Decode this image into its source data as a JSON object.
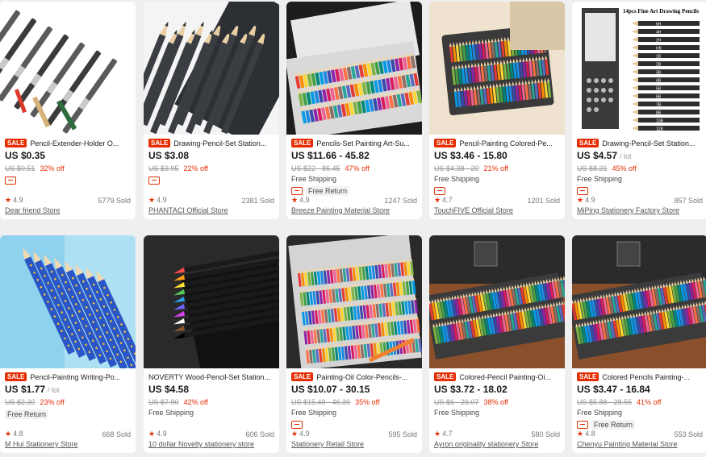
{
  "products": [
    {
      "sale": "SALE",
      "title": "Pencil-Extender-Holder O...",
      "price": "US $0.35",
      "unit": "",
      "orig": "US $0.51",
      "off": "32% off",
      "shipping": "",
      "free_return": "",
      "rating": "4.9",
      "sold": "5779 Sold",
      "store": "Dear friend Store",
      "badge": true,
      "image": "extenders"
    },
    {
      "sale": "SALE",
      "title": "Drawing-Pencil-Set Station...",
      "price": "US $3.08",
      "unit": "",
      "orig": "US $3.95",
      "off": "22% off",
      "shipping": "",
      "free_return": "",
      "rating": "4.9",
      "sold": "2381 Sold",
      "store": "PHANTACI Official Store",
      "badge": true,
      "image": "graphite-box"
    },
    {
      "sale": "SALE",
      "title": "Pencils-Set Painting Art-Su...",
      "price": "US $11.66 - 45.82",
      "unit": "",
      "orig": "US $22 - 86.45",
      "off": "47% off",
      "shipping": "Free Shipping",
      "free_return": "Free Return",
      "rating": "4.9",
      "sold": "1247 Sold",
      "store": "Breeze Painting Material Store",
      "badge": true,
      "image": "color-tins-dark"
    },
    {
      "sale": "SALE",
      "title": "Pencil-Painting Colored-Pe...",
      "price": "US $3.46 - 15.80",
      "unit": "",
      "orig": "US $4.38 - 20",
      "off": "21% off",
      "shipping": "Free Shipping",
      "free_return": "",
      "rating": "4.7",
      "sold": "1201 Sold",
      "store": "TouchFIVE Official Store",
      "badge": true,
      "image": "color-tin-sketch"
    },
    {
      "sale": "SALE",
      "title": "Drawing-Pencil-Set Station...",
      "price": "US $4.57",
      "unit": "/ lot",
      "orig": "US $8.31",
      "off": "45% off",
      "shipping": "Free Shipping",
      "free_return": "",
      "rating": "4.9",
      "sold": "857 Sold",
      "store": "MiPing Stationery Factory Store",
      "badge": true,
      "image": "sketch-set",
      "box_caption": "14pcs Fine Art Drawing Pencils",
      "grades": [
        "6H",
        "4H",
        "2H",
        "HB",
        "1B",
        "2B",
        "3B",
        "4B",
        "5B",
        "6B",
        "7B",
        "8B",
        "10B",
        "12B"
      ]
    },
    {
      "sale": "SALE",
      "title": "Pencil-Painting Writing-Po...",
      "price": "US $1.77",
      "unit": "/ lot",
      "orig": "US $2.30",
      "off": "23% off",
      "shipping": "",
      "free_return": "Free Return",
      "rating": "4.8",
      "sold": "668 Sold",
      "store": "M Hui Stationery Store",
      "badge": false,
      "image": "blue-dots"
    },
    {
      "sale": "",
      "title": "NOVERTY Wood-Pencil-Set Station...",
      "price": "US $4.58",
      "unit": "",
      "orig": "US $7.90",
      "off": "42% off",
      "shipping": "Free Shipping",
      "free_return": "",
      "rating": "4.9",
      "sold": "606 Sold",
      "store": "10 dollar Novelty stationery store",
      "badge": false,
      "image": "black-fan"
    },
    {
      "sale": "SALE",
      "title": "Painting-Oil Color-Pencils-...",
      "price": "US $10.07 - 30.15",
      "unit": "",
      "orig": "US $15.49 - 46.39",
      "off": "35% off",
      "shipping": "Free Shipping",
      "free_return": "",
      "rating": "4.9",
      "sold": "595 Sold",
      "store": "Stationery Retail Store",
      "badge": true,
      "image": "color-tin-160"
    },
    {
      "sale": "SALE",
      "title": "Colored-Pencil Painting-Oi...",
      "price": "US $3.72 - 18.02",
      "unit": "",
      "orig": "US $6 - 29.07",
      "off": "38% off",
      "shipping": "Free Shipping",
      "free_return": "",
      "rating": "4.7",
      "sold": "580 Sold",
      "store": "Ayron originality stationery Store",
      "badge": false,
      "image": "joseph-set"
    },
    {
      "sale": "SALE",
      "title": "Colored Pencils Painting-...",
      "price": "US $3.47 - 16.84",
      "unit": "",
      "orig": "US $5.88 - 28.55",
      "off": "41% off",
      "shipping": "Free Shipping",
      "free_return": "Free Return",
      "rating": "4.8",
      "sold": "553 Sold",
      "store": "Chenyu Painting Material Store",
      "badge": true,
      "image": "joseph-set"
    }
  ],
  "colors": {
    "sale": "#e62e04",
    "price": "#191919",
    "star": "#e62e04",
    "bg": "#efefef"
  },
  "icons": {
    "rating": "star-icon",
    "badge": "coupon-icon"
  }
}
